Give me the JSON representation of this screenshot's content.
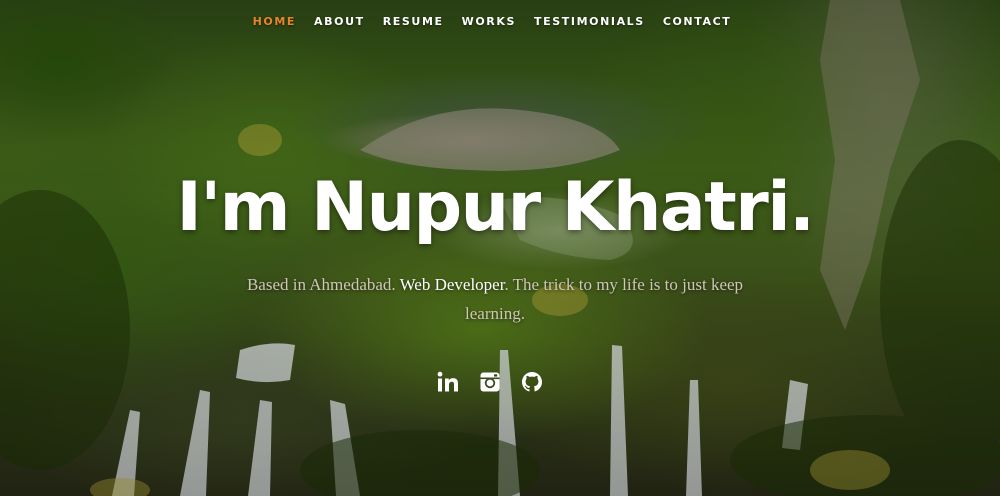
{
  "nav": {
    "items": [
      {
        "label": "HOME",
        "active": true
      },
      {
        "label": "ABOUT",
        "active": false
      },
      {
        "label": "RESUME",
        "active": false
      },
      {
        "label": "WORKS",
        "active": false
      },
      {
        "label": "TESTIMONIALS",
        "active": false
      },
      {
        "label": "CONTACT",
        "active": false
      }
    ],
    "active_color": "#e8842c"
  },
  "hero": {
    "headline": "I'm Nupur Khatri.",
    "subtitle": {
      "before": "Based in Ahmedabad. ",
      "highlight": "Web Developer",
      "after": ". The trick to my life is to just keep learning."
    }
  },
  "social": [
    {
      "icon": "linkedin-icon"
    },
    {
      "icon": "instagram-icon"
    },
    {
      "icon": "github-icon"
    }
  ]
}
